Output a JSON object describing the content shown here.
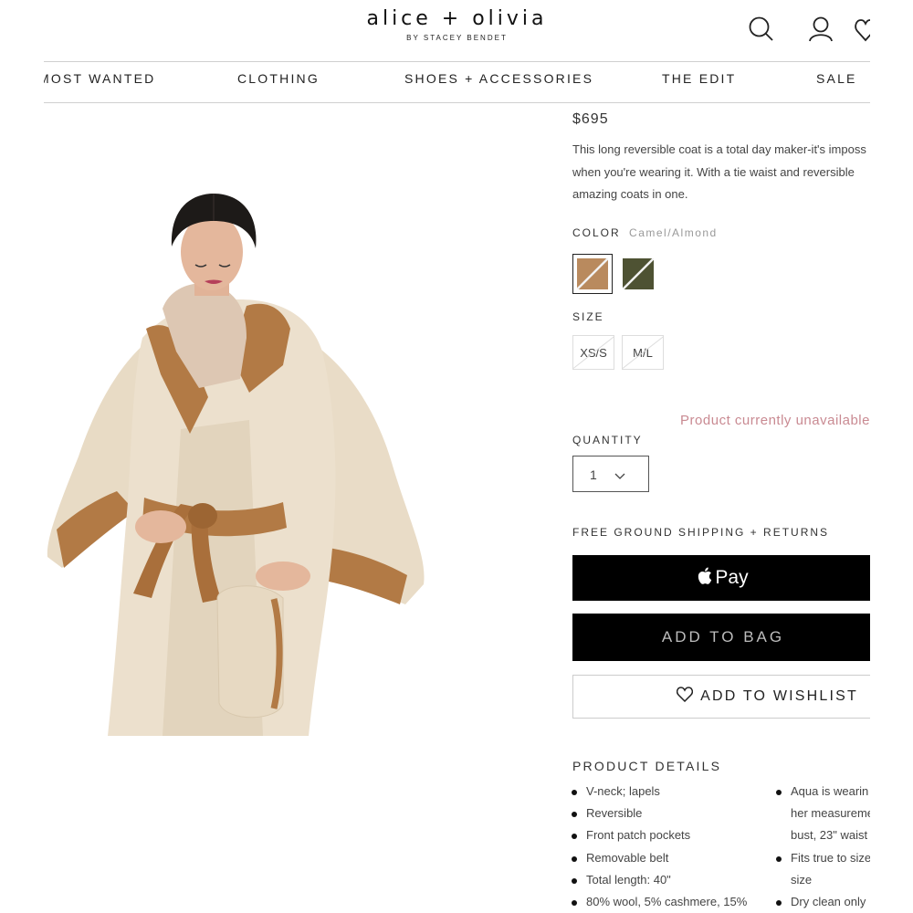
{
  "brand": {
    "name": "alice + olivia",
    "tagline": "BY STACEY BENDET"
  },
  "nav": [
    "MOST WANTED",
    "CLOTHING",
    "SHOES + ACCESSORIES",
    "THE EDIT",
    "SALE"
  ],
  "icons": [
    "search-icon",
    "account-icon",
    "wishlist-heart-icon"
  ],
  "product": {
    "price": "$695",
    "description": [
      "This long reversible coat is a total day maker-it's imposs",
      "when you're wearing it. With a tie waist and reversible",
      "amazing coats in one."
    ],
    "color_label": "COLOR",
    "color_value": "Camel/Almond",
    "colors": [
      {
        "name": "Camel/Almond",
        "hex": "#b98a5e",
        "selected": true,
        "unavailable": true
      },
      {
        "name": "Olive",
        "hex": "#4e5233",
        "selected": false,
        "unavailable": true
      }
    ],
    "size_label": "SIZE",
    "sizes": [
      "XS/S",
      "M/L"
    ],
    "availability": "Product currently unavailable",
    "quantity_label": "QUANTITY",
    "quantity": "1",
    "shipping": "FREE GROUND SHIPPING + RETURNS",
    "apple_pay": "Pay",
    "add_to_bag": "ADD TO BAG",
    "add_to_wishlist": "ADD TO WISHLIST",
    "details_title": "PRODUCT DETAILS",
    "details_left": [
      "V-neck; lapels",
      "Reversible",
      "Front patch pockets",
      "Removable belt",
      "Total length: 40\"",
      "80% wool, 5% cashmere, 15%"
    ],
    "details_right": [
      "Aqua is wearin",
      "her measureme",
      "bust, 23\" waist",
      "Fits true to size",
      "size",
      "Dry clean only"
    ]
  },
  "colors": {
    "coat_light": "#ece0cd",
    "coat_camel": "#b27a45",
    "sweater": "#ddc7b3",
    "hair": "#1d1a18",
    "skin": "#e4b79c",
    "accent_pink": "#c98a92"
  }
}
